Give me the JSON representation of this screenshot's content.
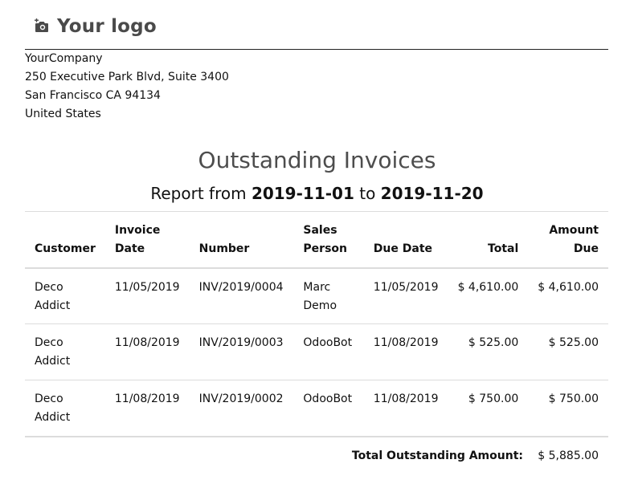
{
  "logo": {
    "text": "Your logo",
    "icon": "camera-plus-icon"
  },
  "company": {
    "name": "YourCompany",
    "street": "250 Executive Park Blvd, Suite 3400",
    "city_line": "San Francisco CA 94134",
    "country": "United States"
  },
  "report": {
    "title": "Outstanding Invoices",
    "subtitle_prefix": "Report from",
    "date_from": "2019-11-01",
    "subtitle_mid": "to",
    "date_to": "2019-11-20"
  },
  "table": {
    "headers": {
      "customer": "Customer",
      "invoice_date_1": "Invoice",
      "invoice_date_2": "Date",
      "number": "Number",
      "sales_person_1": "Sales",
      "sales_person_2": "Person",
      "due_date": "Due Date",
      "total": "Total",
      "amount_due_1": "Amount",
      "amount_due_2": "Due"
    },
    "rows": [
      {
        "customer_1": "Deco",
        "customer_2": "Addict",
        "invoice_date": "11/05/2019",
        "number": "INV/2019/0004",
        "sales_person_1": "Marc",
        "sales_person_2": "Demo",
        "due_date": "11/05/2019",
        "total": "$ 4,610.00",
        "amount_due": "$ 4,610.00"
      },
      {
        "customer_1": "Deco",
        "customer_2": "Addict",
        "invoice_date": "11/08/2019",
        "number": "INV/2019/0003",
        "sales_person_1": "OdooBot",
        "sales_person_2": "",
        "due_date": "11/08/2019",
        "total": "$ 525.00",
        "amount_due": "$ 525.00"
      },
      {
        "customer_1": "Deco",
        "customer_2": "Addict",
        "invoice_date": "11/08/2019",
        "number": "INV/2019/0002",
        "sales_person_1": "OdooBot",
        "sales_person_2": "",
        "due_date": "11/08/2019",
        "total": "$ 750.00",
        "amount_due": "$ 750.00"
      }
    ]
  },
  "summary": {
    "label": "Total Outstanding Amount:",
    "value": "$ 5,885.00"
  }
}
